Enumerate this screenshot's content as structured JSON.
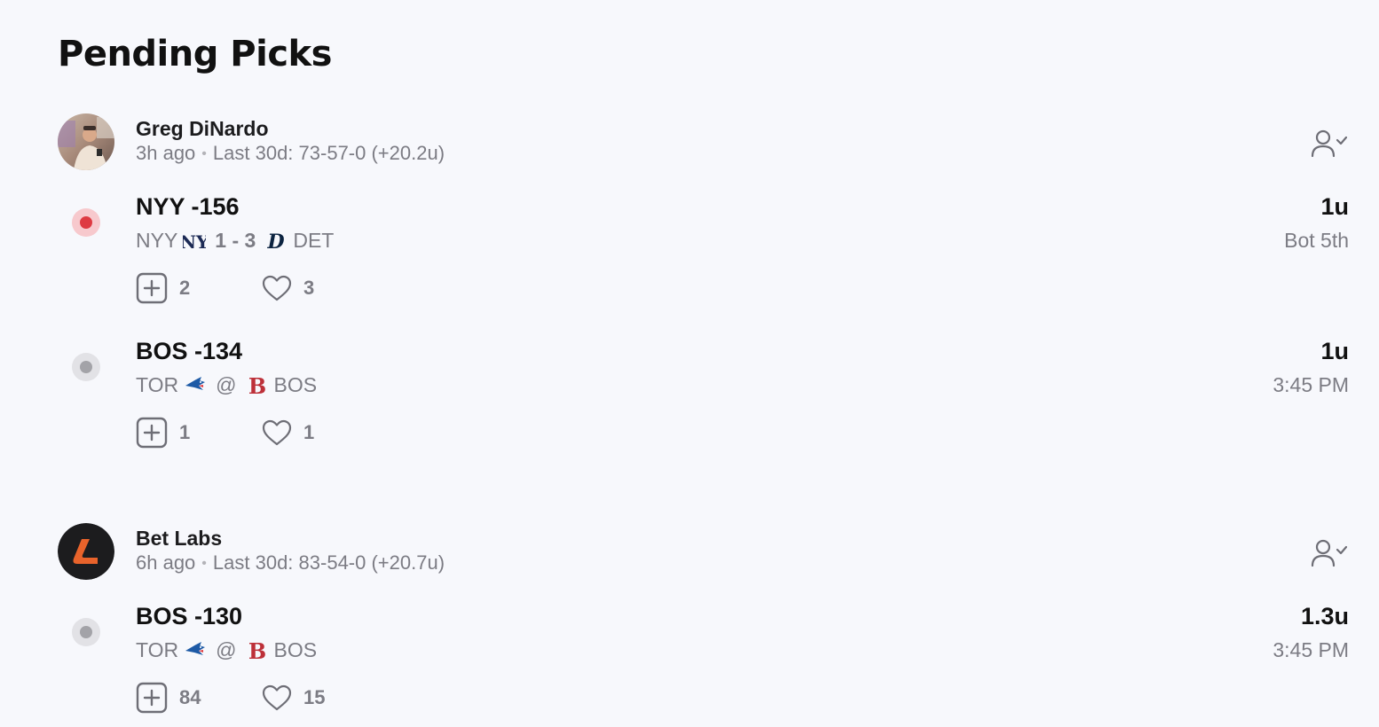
{
  "page": {
    "title": "Pending Picks"
  },
  "authors": [
    {
      "name": "Greg DiNardo",
      "time_ago": "3h ago",
      "record": "Last 30d: 73-57-0 (+20.2u)",
      "avatar_icon": "greg-photo-avatar",
      "picks": [
        {
          "title": "NYY -156",
          "status": "live",
          "away_team": "NYY",
          "away_logo": "yankees-logo-icon",
          "separator": "1 - 3",
          "home_logo": "tigers-logo-icon",
          "home_team": "DET",
          "units": "1u",
          "game_time": "Bot 5th",
          "tails": "2",
          "likes": "3"
        },
        {
          "title": "BOS -134",
          "status": "pending",
          "away_team": "TOR",
          "away_logo": "blue-jays-logo-icon",
          "separator": "@",
          "home_logo": "red-sox-logo-icon",
          "home_team": "BOS",
          "units": "1u",
          "game_time": "3:45 PM",
          "tails": "1",
          "likes": "1"
        }
      ]
    },
    {
      "name": "Bet Labs",
      "time_ago": "6h ago",
      "record": "Last 30d: 83-54-0 (+20.7u)",
      "avatar_icon": "bet-labs-logo-avatar",
      "picks": [
        {
          "title": "BOS -130",
          "status": "pending",
          "away_team": "TOR",
          "away_logo": "blue-jays-logo-icon",
          "separator": "@",
          "home_logo": "red-sox-logo-icon",
          "home_team": "BOS",
          "units": "1.3u",
          "game_time": "3:45 PM",
          "tails": "84",
          "likes": "15"
        }
      ]
    }
  ],
  "colors": {
    "background": "#f7f8fc",
    "live_status": "#de3a42",
    "pending_status": "#a3a3a8",
    "muted_text": "#7c7c84",
    "bet_labs_orange": "#e8632b"
  }
}
